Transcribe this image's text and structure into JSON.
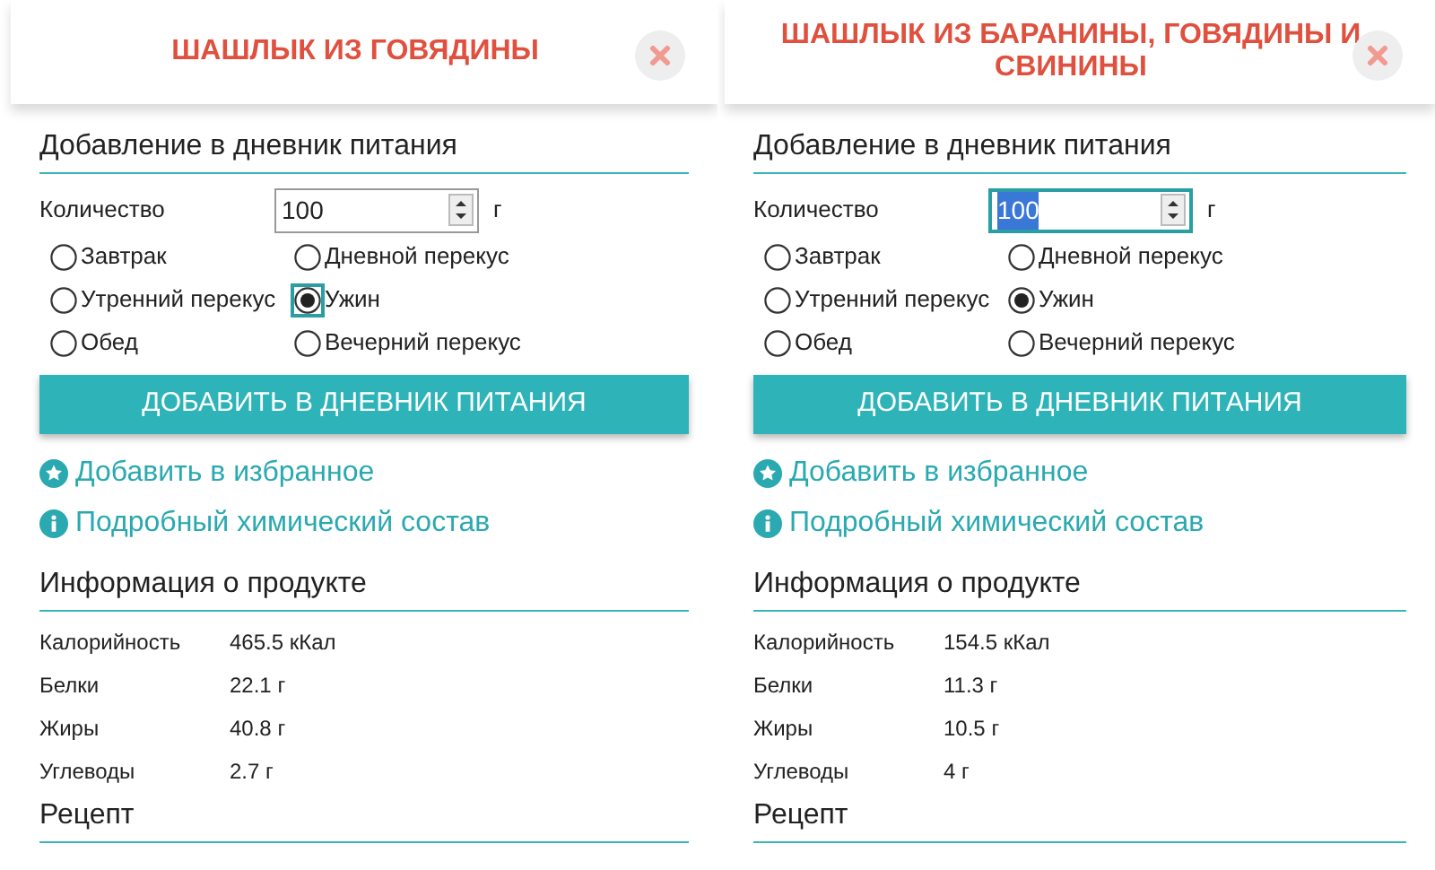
{
  "panels": [
    {
      "title": "ШАШЛЫК ИЗ ГОВЯДИНЫ",
      "add_heading": "Добавление в дневник питания",
      "quantity_label": "Количество",
      "quantity_value": "100",
      "quantity_focused": false,
      "unit": "г",
      "meals": [
        {
          "label": "Завтрак",
          "selected": false,
          "focused": false
        },
        {
          "label": "Утренний перекус",
          "selected": false,
          "focused": false
        },
        {
          "label": "Обед",
          "selected": false,
          "focused": false
        },
        {
          "label": "Дневной перекус",
          "selected": false,
          "focused": false
        },
        {
          "label": "Ужин",
          "selected": true,
          "focused": true
        },
        {
          "label": "Вечерний перекус",
          "selected": false,
          "focused": false
        }
      ],
      "add_button": "ДОБАВИТЬ В ДНЕВНИК ПИТАНИЯ",
      "links": [
        {
          "kind": "favorite",
          "label": "Добавить в избранное"
        },
        {
          "kind": "info",
          "label": "Подробный химический состав"
        }
      ],
      "info_heading": "Информация о продукте",
      "nutrients": [
        {
          "name": "Калорийность",
          "value": "465.5 кКал"
        },
        {
          "name": "Белки",
          "value": "22.1 г"
        },
        {
          "name": "Жиры",
          "value": "40.8 г"
        },
        {
          "name": "Углеводы",
          "value": "2.7 г"
        }
      ],
      "recipe_heading": "Рецепт"
    },
    {
      "title": "ШАШЛЫК ИЗ БАРАНИНЫ, ГОВЯДИНЫ И СВИНИНЫ",
      "add_heading": "Добавление в дневник питания",
      "quantity_label": "Количество",
      "quantity_value": "100",
      "quantity_focused": true,
      "unit": "г",
      "meals": [
        {
          "label": "Завтрак",
          "selected": false,
          "focused": false
        },
        {
          "label": "Утренний перекус",
          "selected": false,
          "focused": false
        },
        {
          "label": "Обед",
          "selected": false,
          "focused": false
        },
        {
          "label": "Дневной перекус",
          "selected": false,
          "focused": false
        },
        {
          "label": "Ужин",
          "selected": true,
          "focused": false
        },
        {
          "label": "Вечерний перекус",
          "selected": false,
          "focused": false
        }
      ],
      "add_button": "ДОБАВИТЬ В ДНЕВНИК ПИТАНИЯ",
      "links": [
        {
          "kind": "favorite",
          "label": "Добавить в избранное"
        },
        {
          "kind": "info",
          "label": "Подробный химический состав"
        }
      ],
      "info_heading": "Информация о продукте",
      "nutrients": [
        {
          "name": "Калорийность",
          "value": "154.5 кКал"
        },
        {
          "name": "Белки",
          "value": "11.3 г"
        },
        {
          "name": "Жиры",
          "value": "10.5 г"
        },
        {
          "name": "Углеводы",
          "value": "4 г"
        }
      ],
      "recipe_heading": "Рецепт"
    }
  ]
}
